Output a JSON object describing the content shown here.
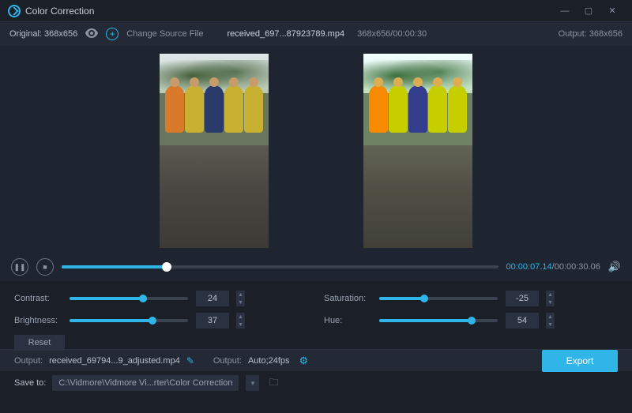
{
  "window": {
    "title": "Color Correction"
  },
  "header": {
    "original_label": "Original: 368x656",
    "change_source": "Change Source File",
    "filename": "received_697...87923789.mp4",
    "meta": "368x656/00:00:30",
    "output_label": "Output: 368x656"
  },
  "transport": {
    "current": "00:00:07.14",
    "total": "/00:00:30.06"
  },
  "sliders": {
    "contrast": {
      "label": "Contrast:",
      "value": "24",
      "pct": 62
    },
    "saturation": {
      "label": "Saturation:",
      "value": "-25",
      "pct": 38
    },
    "brightness": {
      "label": "Brightness:",
      "value": "37",
      "pct": 70
    },
    "hue": {
      "label": "Hue:",
      "value": "54",
      "pct": 78
    },
    "reset": "Reset"
  },
  "output": {
    "label1": "Output:",
    "filename": "received_69794...9_adjusted.mp4",
    "label2": "Output:",
    "format": "Auto;24fps",
    "export": "Export"
  },
  "save": {
    "label": "Save to:",
    "path": "C:\\Vidmore\\Vidmore Vi...rter\\Color Correction"
  }
}
